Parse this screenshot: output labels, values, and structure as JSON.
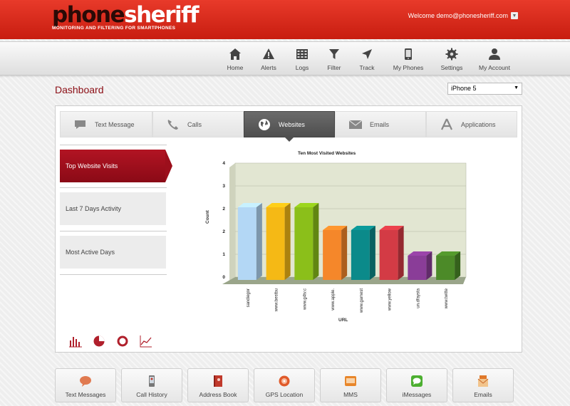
{
  "header": {
    "logo_part1": "phone",
    "logo_part2": "sheriff",
    "tagline": "MONITORING AND FILTERING FOR SMARTPHONES",
    "welcome": "Welcome demo@phonesheriff.com"
  },
  "nav": {
    "items": [
      {
        "label": "Home",
        "icon": "home-icon"
      },
      {
        "label": "Alerts",
        "icon": "alert-icon"
      },
      {
        "label": "Logs",
        "icon": "logs-icon"
      },
      {
        "label": "Filter",
        "icon": "filter-icon"
      },
      {
        "label": "Track",
        "icon": "track-icon"
      },
      {
        "label": "My Phones",
        "icon": "phone-icon"
      },
      {
        "label": "Settings",
        "icon": "gear-icon"
      },
      {
        "label": "My Account",
        "icon": "user-icon"
      }
    ]
  },
  "page": {
    "title": "Dashboard",
    "phone_selected": "iPhone 5"
  },
  "tabs": [
    {
      "label": "Text Message",
      "icon": "chat-icon"
    },
    {
      "label": "Calls",
      "icon": "call-icon"
    },
    {
      "label": "Websites",
      "icon": "globe-icon",
      "active": true
    },
    {
      "label": "Emails",
      "icon": "email-icon"
    },
    {
      "label": "Applications",
      "icon": "apps-icon"
    }
  ],
  "side": {
    "items": [
      {
        "label": "Top Website Visits",
        "active": true
      },
      {
        "label": "Last 7 Days Activity"
      },
      {
        "label": "Most Active Days"
      }
    ]
  },
  "chart_icons": [
    "bar-chart-icon",
    "pie-chart-icon",
    "donut-chart-icon",
    "line-chart-icon"
  ],
  "chart_data": {
    "type": "bar",
    "title": "Ten Most Visited Websites",
    "xlabel": "URL",
    "ylabel": "Count",
    "ylim": [
      0,
      4
    ],
    "yticks": [
      "0",
      "1",
      "2",
      "2",
      "3",
      "4"
    ],
    "categories": [
      "sandiegor",
      "www.bestbu",
      "www.g4tv.c",
      "www.apple.",
      "www.gamest",
      "www.yellow",
      "un.dfaysta",
      "www.twitte"
    ],
    "values": [
      2.6,
      2.6,
      2.6,
      1.8,
      1.8,
      1.8,
      0.9,
      0.9
    ],
    "colors": [
      "#b3d7f5",
      "#f5b915",
      "#8bbf1a",
      "#f5872a",
      "#0b8a8a",
      "#d33b45",
      "#8a3d98",
      "#4c8a28"
    ],
    "grid": true
  },
  "bottom_tiles": [
    {
      "label": "Text Messages",
      "icon": "sms-icon",
      "color": "#e07a50"
    },
    {
      "label": "Call History",
      "icon": "call-history-icon",
      "color": "#888888"
    },
    {
      "label": "Address Book",
      "icon": "address-book-icon",
      "color": "#c0392b"
    },
    {
      "label": "GPS Location",
      "icon": "gps-icon",
      "color": "#e05a2a"
    },
    {
      "label": "MMS",
      "icon": "mms-icon",
      "color": "#e8862a"
    },
    {
      "label": "iMessages",
      "icon": "imessage-icon",
      "color": "#4caf30"
    },
    {
      "label": "Emails",
      "icon": "email-tile-icon",
      "color": "#e0792a"
    }
  ]
}
